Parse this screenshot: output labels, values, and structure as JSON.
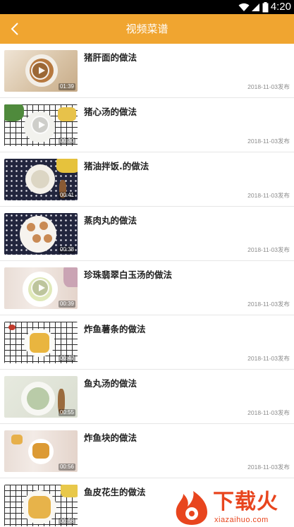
{
  "status_bar": {
    "time": "4:20",
    "icons": [
      "wifi-icon",
      "signal-icon",
      "battery-icon"
    ]
  },
  "app_bar": {
    "title": "视频菜谱",
    "back_icon": "chevron-left-icon",
    "background": "#f0a530"
  },
  "items": [
    {
      "title": "猪肝面的做法",
      "duration": "01:39",
      "date": "2018-11-03发布",
      "thumb": "rustic"
    },
    {
      "title": "猪心汤的做法",
      "duration": "00:30",
      "date": "2018-11-03发布",
      "thumb": "plaid"
    },
    {
      "title": "猪油拌饭.的做法",
      "duration": "00:41",
      "date": "2018-11-03发布",
      "thumb": "navy"
    },
    {
      "title": "蒸肉丸的做法",
      "duration": "00:38",
      "date": "2018-11-03发布",
      "thumb": "navy"
    },
    {
      "title": "珍珠翡翠白玉汤的做法",
      "duration": "00:39",
      "date": "2018-11-03发布",
      "thumb": "wood"
    },
    {
      "title": "炸鱼薯条的做法",
      "duration": "00:47",
      "date": "2018-11-03发布",
      "thumb": "plaid"
    },
    {
      "title": "鱼丸汤的做法",
      "duration": "00:55",
      "date": "2018-11-03发布",
      "thumb": "sage"
    },
    {
      "title": "炸鱼块的做法",
      "duration": "00:56",
      "date": "2018-11-03发布",
      "thumb": "wood"
    },
    {
      "title": "鱼皮花生的做法",
      "duration": "00:58",
      "date": "",
      "thumb": "plaid"
    }
  ],
  "watermark": {
    "brand": "下载火",
    "domain": "xiazaihuo.com",
    "color": "#e8451e"
  }
}
